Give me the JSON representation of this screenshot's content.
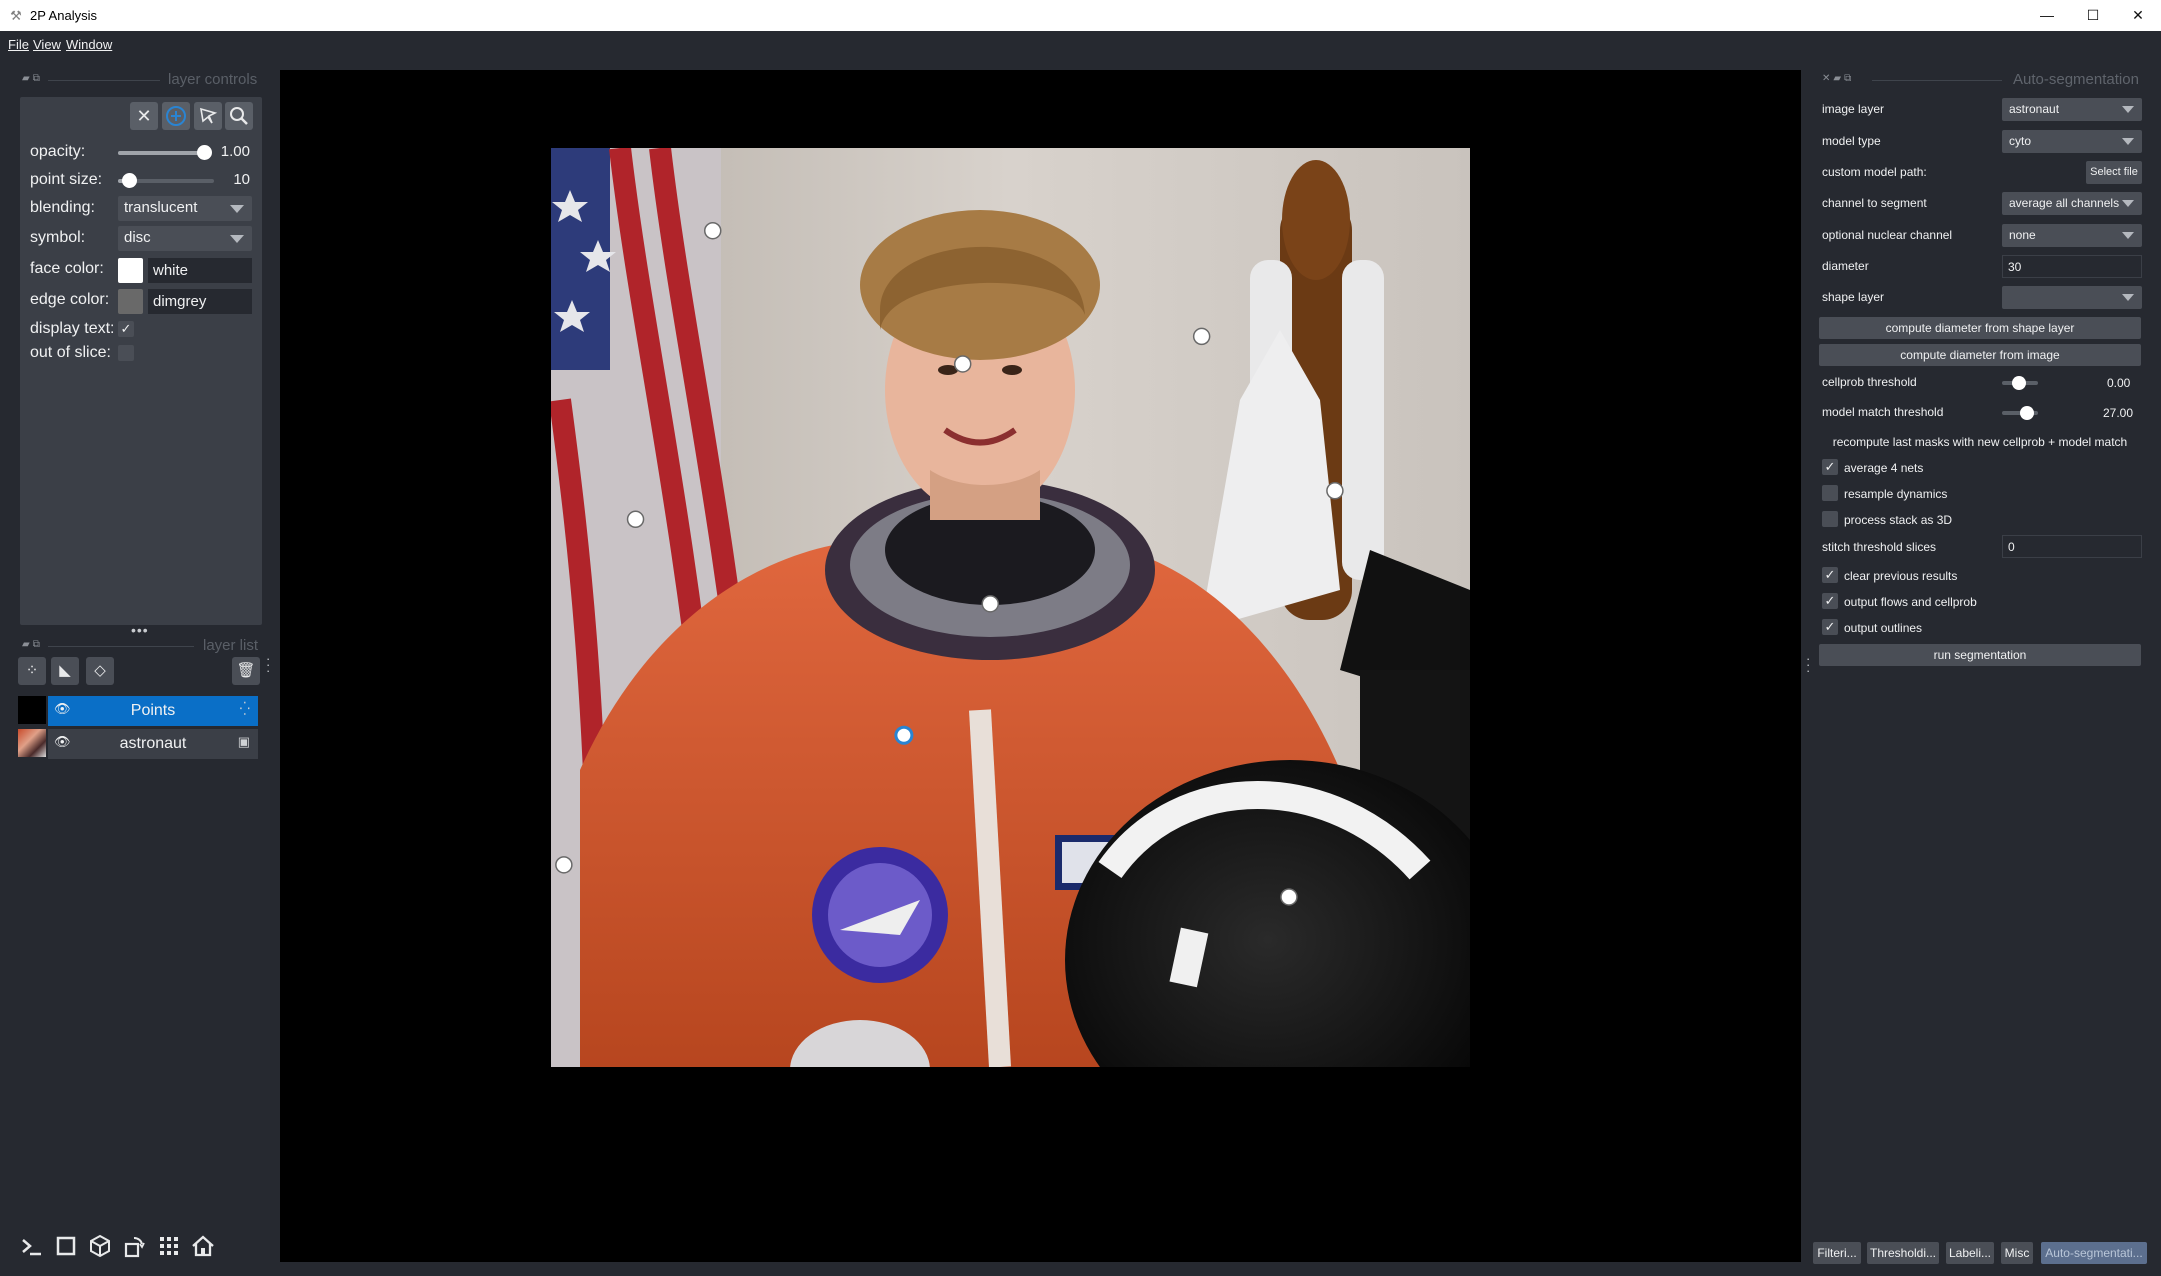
{
  "window": {
    "title": "2P Analysis",
    "minimize_glyph": "—",
    "maximize_glyph": "☐",
    "close_glyph": "✕"
  },
  "menubar": {
    "items": [
      "File",
      "View",
      "Window"
    ]
  },
  "layer_controls": {
    "dock_title": "layer controls",
    "mode_buttons": [
      "close-icon",
      "add-point-icon",
      "select-icon",
      "zoom-icon"
    ],
    "opacity": {
      "label": "opacity:",
      "value_text": "1.00",
      "value": 1.0
    },
    "point_size": {
      "label": "point size:",
      "value_text": "10",
      "value": 10
    },
    "blending": {
      "label": "blending:",
      "value": "translucent"
    },
    "symbol": {
      "label": "symbol:",
      "value": "disc"
    },
    "face_color": {
      "label": "face color:",
      "value": "white",
      "swatch": "#ffffff"
    },
    "edge_color": {
      "label": "edge color:",
      "value": "dimgrey",
      "swatch": "#696969"
    },
    "display_text": {
      "label": "display text:",
      "checked": true
    },
    "out_of_slice": {
      "label": "out of slice:",
      "checked": false
    }
  },
  "layer_list": {
    "dock_title": "layer list",
    "layers": [
      {
        "name": "Points",
        "selected": true,
        "visible": true,
        "type_icon": "points-icon"
      },
      {
        "name": "astronaut",
        "selected": false,
        "visible": true,
        "type_icon": "image-icon"
      }
    ]
  },
  "viewer": {
    "image_layer": "astronaut",
    "points": [
      {
        "x": 0.176,
        "y": 0.09,
        "selected": false
      },
      {
        "x": 0.448,
        "y": 0.235,
        "selected": false
      },
      {
        "x": 0.708,
        "y": 0.205,
        "selected": false
      },
      {
        "x": 0.853,
        "y": 0.373,
        "selected": false
      },
      {
        "x": 0.092,
        "y": 0.404,
        "selected": false
      },
      {
        "x": 0.478,
        "y": 0.496,
        "selected": false
      },
      {
        "x": 0.384,
        "y": 0.639,
        "selected": true
      },
      {
        "x": 0.014,
        "y": 0.78,
        "selected": false
      },
      {
        "x": 0.803,
        "y": 0.815,
        "selected": false
      }
    ]
  },
  "bottom_toolbar": {
    "buttons": [
      "console-icon",
      "square-icon",
      "cube-icon",
      "rotate-icon",
      "grid-icon",
      "home-icon"
    ]
  },
  "auto_segmentation": {
    "dock_title": "Auto-segmentation",
    "image_layer": {
      "label": "image layer",
      "value": "astronaut"
    },
    "model_type": {
      "label": "model type",
      "value": "cyto"
    },
    "custom_model_path": {
      "label": "custom model path:",
      "button": "Select file"
    },
    "channel_to_segment": {
      "label": "channel to segment",
      "value": "average all channels"
    },
    "optional_nuclear_channel": {
      "label": "optional nuclear channel",
      "value": "none"
    },
    "diameter": {
      "label": "diameter",
      "value": "30"
    },
    "shape_layer": {
      "label": "shape layer",
      "value": ""
    },
    "compute_from_shape": "compute diameter from shape layer",
    "compute_from_image": "compute diameter from image",
    "cellprob_threshold": {
      "label": "cellprob threshold",
      "value_text": "0.00"
    },
    "model_match_threshold": {
      "label": "model match threshold",
      "value_text": "27.00"
    },
    "recompute_label": "recompute last masks with new cellprob + model match",
    "average_4_nets": {
      "label": "average 4 nets",
      "checked": true
    },
    "resample_dynamics": {
      "label": "resample dynamics",
      "checked": false
    },
    "process_stack_3d": {
      "label": "process stack as 3D",
      "checked": false
    },
    "stitch_threshold": {
      "label": "stitch threshold slices",
      "value": "0"
    },
    "clear_previous": {
      "label": "clear previous results",
      "checked": true
    },
    "output_flows": {
      "label": "output flows and cellprob",
      "checked": true
    },
    "output_outlines": {
      "label": "output outlines",
      "checked": true
    },
    "run_button": "run segmentation"
  },
  "dock_tabs": [
    "Filteri...",
    "Thresholdi...",
    "Labeli...",
    "Misc",
    "Auto-segmentati..."
  ],
  "colors": {
    "background": "#262930",
    "panel": "#3b3f47",
    "control": "#4a4e56",
    "selection": "#0a6fc7",
    "accent": "#2a84d2"
  }
}
